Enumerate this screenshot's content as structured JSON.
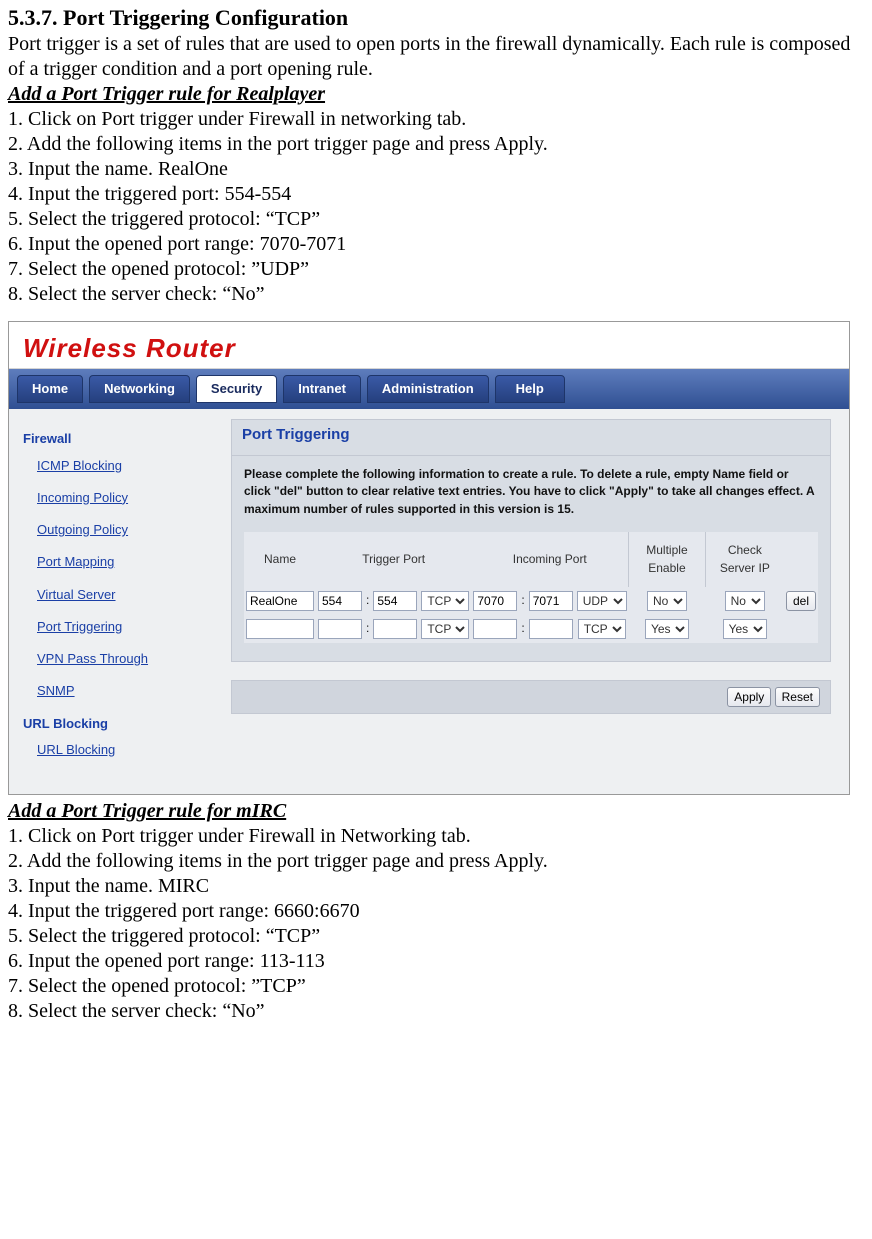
{
  "doc": {
    "heading": "5.3.7. Port Triggering Configuration",
    "intro": "Port trigger is a set of rules that are used to open ports in the firewall dynamically. Each rule is composed of a trigger condition and a port opening rule.",
    "sub1": "Add a Port Trigger rule for Realplayer",
    "steps1": [
      "1. Click on Port trigger under Firewall in networking tab.",
      "2. Add the following items in the port trigger page and press Apply.",
      "3. Input the name. RealOne",
      "4. Input the triggered port: 554-554",
      "5. Select the triggered protocol:  “TCP”",
      "6. Input the opened port range: 7070-7071",
      "7. Select the opened protocol: ”UDP”",
      "8. Select the server check: “No”"
    ],
    "sub2": "Add a Port Trigger rule for mIRC",
    "steps2": [
      "1. Click on Port trigger under Firewall in Networking tab.",
      "2. Add the following items in the port trigger page and press Apply.",
      "3. Input the name. MIRC",
      "4. Input the triggered port range: 6660:6670",
      "5. Select the triggered protocol:  “TCP”",
      "6. Input the opened port range: 113-113",
      "7. Select the opened protocol: ”TCP”",
      "8. Select the server check: “No”"
    ]
  },
  "router": {
    "logo": "Wireless Router",
    "nav": {
      "home": "Home",
      "networking": "Networking",
      "security": "Security",
      "intranet": "Intranet",
      "administration": "Administration",
      "help": "Help"
    },
    "sidebar": {
      "group1": "Firewall",
      "items1": [
        "ICMP Blocking",
        "Incoming Policy",
        "Outgoing Policy",
        "Port Mapping",
        "Virtual Server",
        "Port Triggering",
        "VPN Pass Through",
        "SNMP"
      ],
      "group2": "URL Blocking",
      "items2": [
        "URL Blocking"
      ]
    },
    "panel": {
      "title": "Port Triggering",
      "desc": "Please complete the following information to create a rule. To delete a rule, empty Name field or click \"del\" button to clear relative text entries. You have to click \"Apply\" to take all changes effect. A maximum number of rules supported in this version is 15.",
      "headers": {
        "name": "Name",
        "trigger": "Trigger Port",
        "incoming": "Incoming Port",
        "multi": "Multiple Enable",
        "check": "Check Server IP"
      },
      "rows": [
        {
          "name": "RealOne",
          "tp_from": "554",
          "tp_to": "554",
          "t_proto": "TCP",
          "ip_from": "7070",
          "ip_to": "7071",
          "i_proto": "UDP",
          "multi": "No",
          "check": "No",
          "del": "del"
        },
        {
          "name": "",
          "tp_from": "",
          "tp_to": "",
          "t_proto": "TCP",
          "ip_from": "",
          "ip_to": "",
          "i_proto": "TCP",
          "multi": "Yes",
          "check": "Yes",
          "del": ""
        }
      ],
      "apply": "Apply",
      "reset": "Reset"
    }
  }
}
